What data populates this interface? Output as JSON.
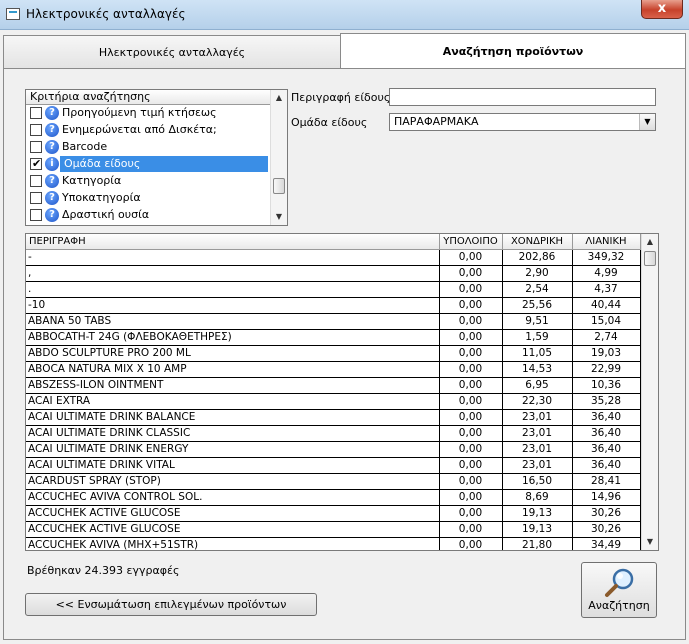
{
  "window": {
    "title": "Ηλεκτρονικές ανταλλαγές",
    "close_glyph": "x"
  },
  "tabs": [
    {
      "label": "Ηλεκτρονικές ανταλλαγές"
    },
    {
      "label": "Αναζήτηση προϊόντων"
    }
  ],
  "criteria": {
    "header": "Κριτήρια αναζήτησης",
    "items": [
      {
        "label": "Προηγούμενη τιμή κτήσεως",
        "checked": false,
        "icon": "?"
      },
      {
        "label": "Ενημερώνεται από Δισκέτα;",
        "checked": false,
        "icon": "?"
      },
      {
        "label": "Barcode",
        "checked": false,
        "icon": "?"
      },
      {
        "label": "Ομάδα είδους",
        "checked": true,
        "icon": "i",
        "selected": true
      },
      {
        "label": "Κατηγορία",
        "checked": false,
        "icon": "?"
      },
      {
        "label": "Υποκατηγορία",
        "checked": false,
        "icon": "?"
      },
      {
        "label": "Δραστική ουσία",
        "checked": false,
        "icon": "?"
      }
    ]
  },
  "filters": {
    "description_label": "Περιγραφή είδους",
    "description_value": "",
    "group_label": "Ομάδα είδους",
    "group_value": "ΠΑΡΑΦΑΡΜΑΚΑ"
  },
  "grid": {
    "columns": [
      "ΠΕΡΙΓΡΑΦΗ",
      "ΥΠΟΛΟΙΠΟ",
      "ΧΟΝΔΡΙΚΗ",
      "ΛΙΑΝΙΚΗ"
    ],
    "rows": [
      [
        "-",
        "0,00",
        "202,86",
        "349,32"
      ],
      [
        ",",
        "0,00",
        "2,90",
        "4,99"
      ],
      [
        ".",
        "0,00",
        "2,54",
        "4,37"
      ],
      [
        "-10",
        "0,00",
        "25,56",
        "40,44"
      ],
      [
        "ABANA 50 TABS",
        "0,00",
        "9,51",
        "15,04"
      ],
      [
        "ABBOCATH-T 24G (ΦΛΕΒΟΚΑΘΕΤΗΡΕΣ)",
        "0,00",
        "1,59",
        "2,74"
      ],
      [
        "ABDO SCULPTURE PRO 200 ML",
        "0,00",
        "11,05",
        "19,03"
      ],
      [
        "ABOCA NATURA MIX X 10 AMP",
        "0,00",
        "14,53",
        "22,99"
      ],
      [
        "ABSZESS-ILON OINTMENT",
        "0,00",
        "6,95",
        "10,36"
      ],
      [
        "ACAI EXTRA",
        "0,00",
        "22,30",
        "35,28"
      ],
      [
        "ACAI ULTIMATE DRINK BALANCE",
        "0,00",
        "23,01",
        "36,40"
      ],
      [
        "ACAI ULTIMATE DRINK CLASSIC",
        "0,00",
        "23,01",
        "36,40"
      ],
      [
        "ACAI ULTIMATE DRINK ENERGY",
        "0,00",
        "23,01",
        "36,40"
      ],
      [
        "ACAI ULTIMATE DRINK VITAL",
        "0,00",
        "23,01",
        "36,40"
      ],
      [
        "ACARDUST       SPRAY (STOP)",
        "0,00",
        "16,50",
        "28,41"
      ],
      [
        "ACCUCHEC AVIVA CONTROL SOL.",
        "0,00",
        "8,69",
        "14,96"
      ],
      [
        "ACCUCHEK ACTIVE GLUCOSE",
        "0,00",
        "19,13",
        "30,26"
      ],
      [
        "ACCUCHEK ACTIVE GLUCOSE",
        "0,00",
        "19,13",
        "30,26"
      ],
      [
        "ACCUCHEK AVIVA (MHX+51STR)",
        "0,00",
        "21,80",
        "34,49"
      ]
    ]
  },
  "footer": {
    "found_text": "Βρέθηκαν 24.393 εγγραφές",
    "embed_button": "<< Ενσωμάτωση επιλεγμένων προϊόντων",
    "search_button": "Αναζήτηση"
  }
}
